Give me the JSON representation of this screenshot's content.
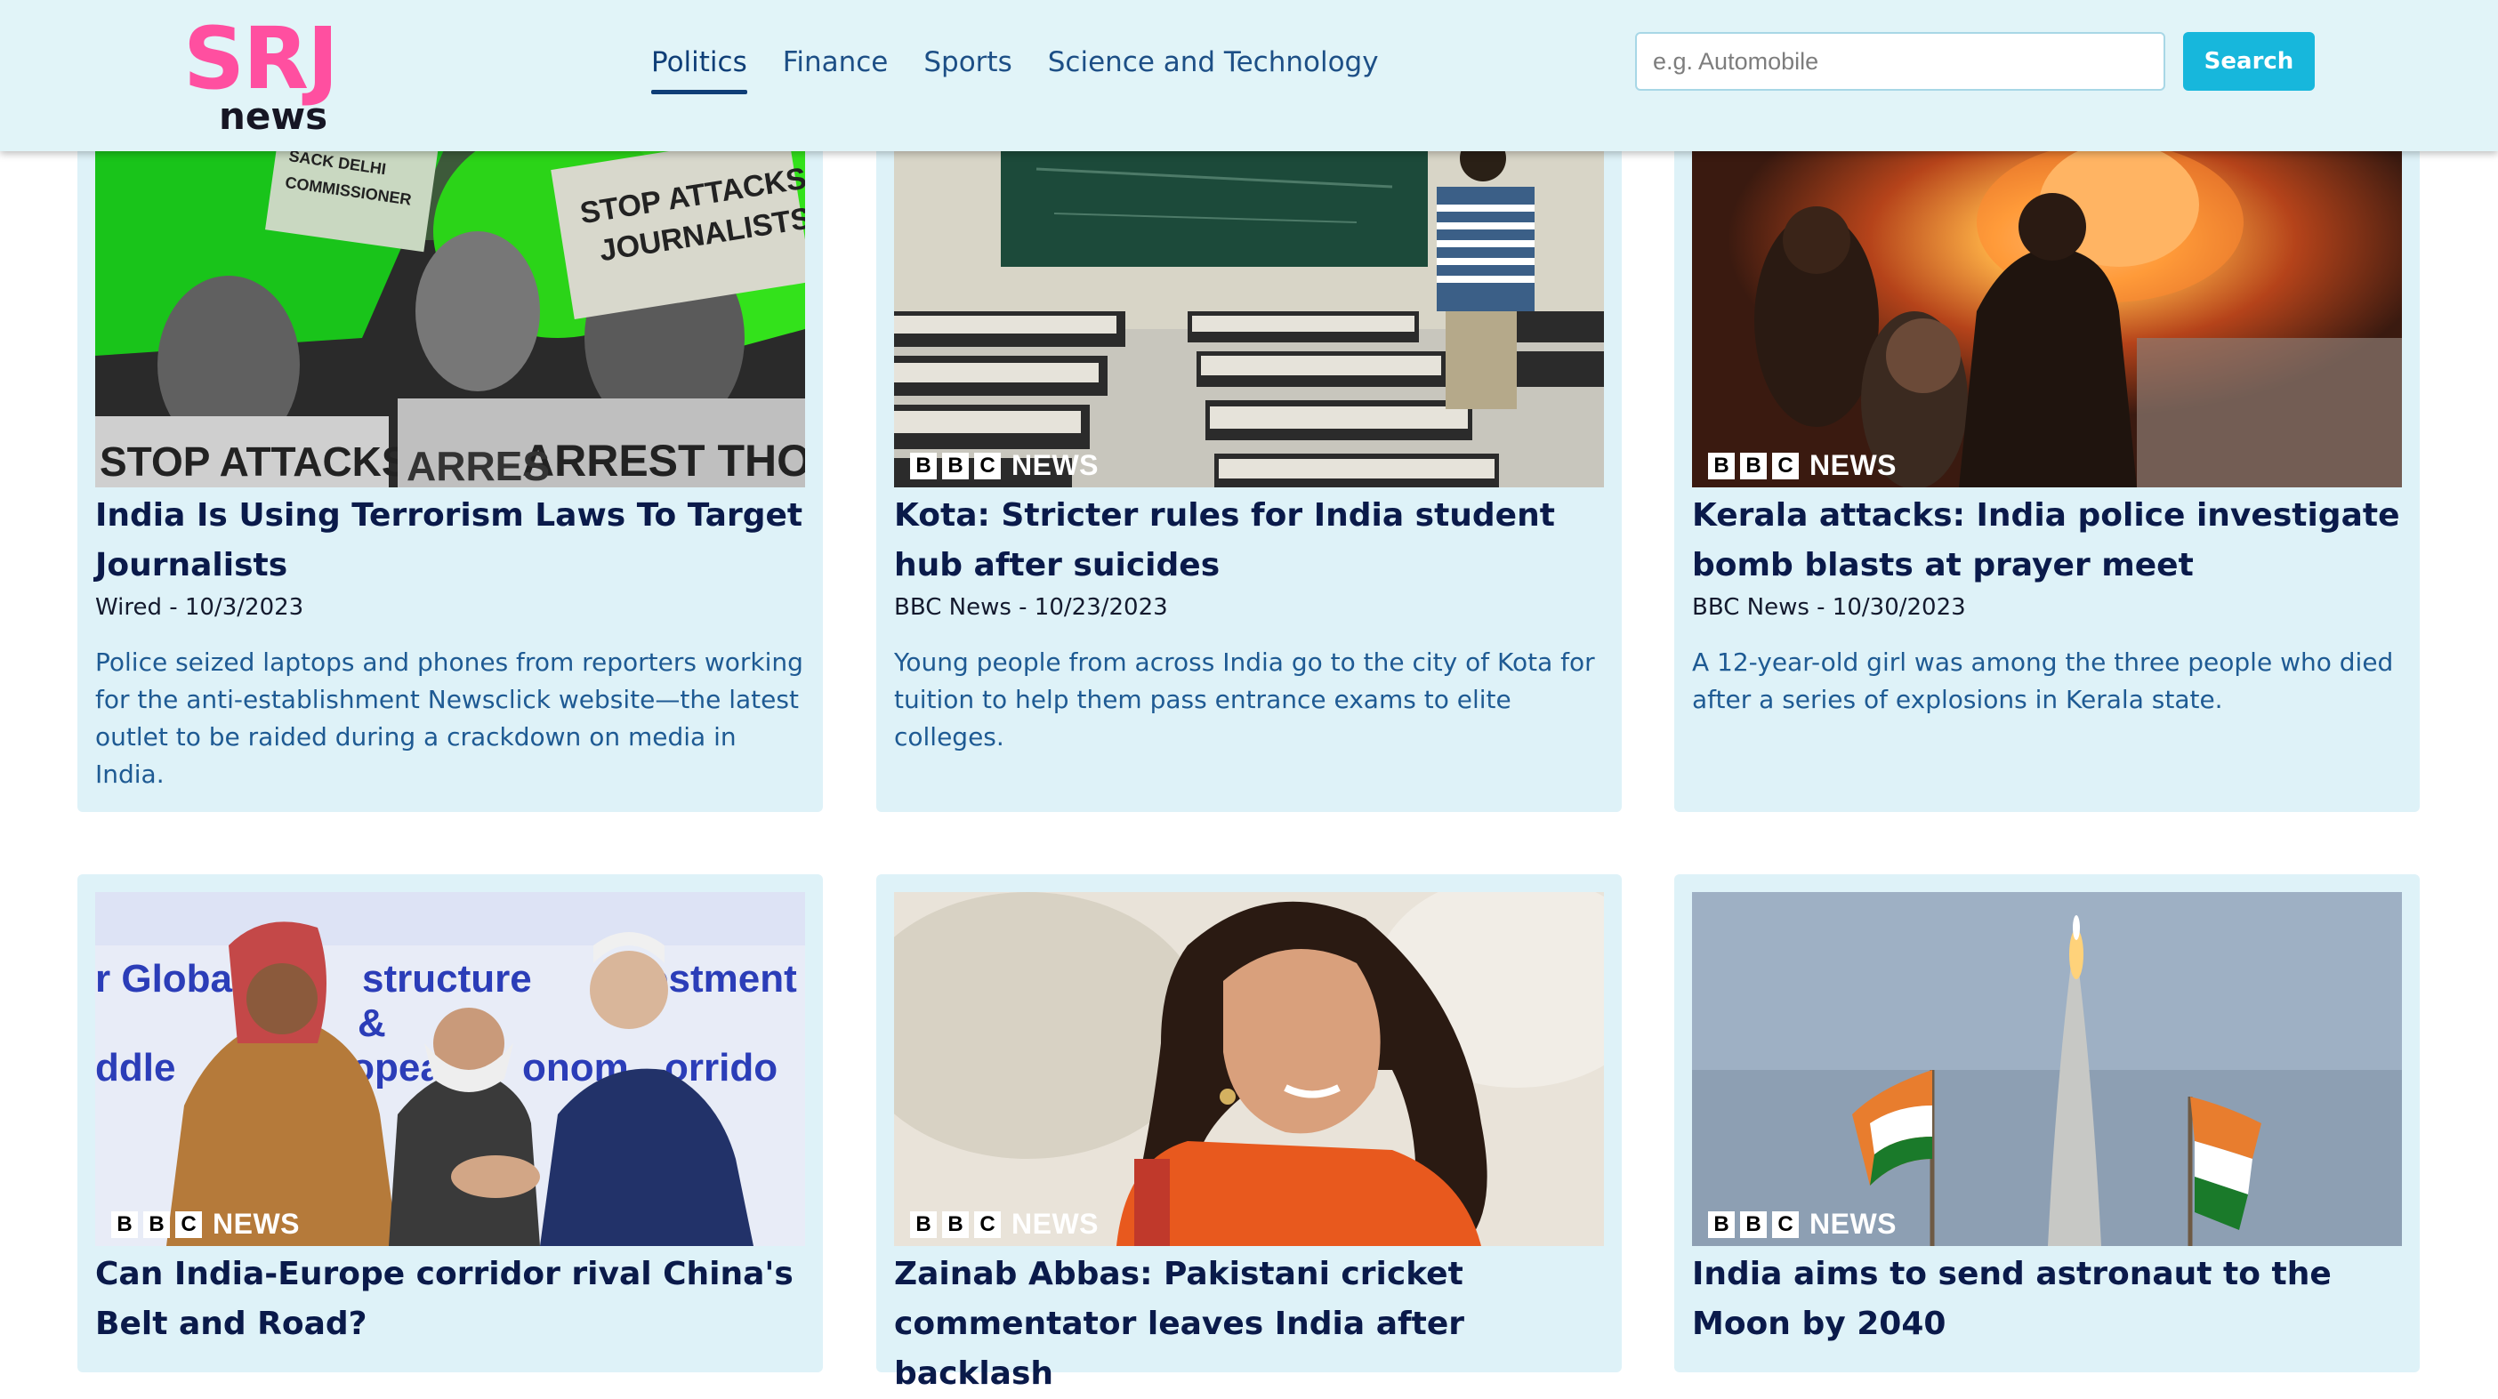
{
  "header": {
    "logo_main": "SRJ",
    "logo_sub": "news",
    "nav": [
      {
        "label": "Politics",
        "active": true
      },
      {
        "label": "Finance",
        "active": false
      },
      {
        "label": "Sports",
        "active": false
      },
      {
        "label": "Science and Technology",
        "active": false
      }
    ],
    "search_placeholder": "e.g. Automobile",
    "search_button": "Search"
  },
  "colors": {
    "header_bg": "#e1f4f8",
    "logo_pink": "#ff4fa0",
    "card_bg": "#def2f8",
    "accent": "#17b7dc",
    "title_navy": "#0a1a4a",
    "desc_blue": "#1e5a93"
  },
  "articles": [
    {
      "title": "India Is Using Terrorism Laws To Target Journalists",
      "meta": "Wired - 10/3/2023",
      "description": "Police seized laptops and phones from reporters working for the anti-establishment Newsclick website—the latest outlet to be raided during a crackdown on media in India.",
      "image": "protest-photo",
      "bbc_badge": false
    },
    {
      "title": "Kota: Stricter rules for India student hub after suicides",
      "meta": "BBC News - 10/23/2023",
      "description": "Young people from across India go to the city of Kota for tuition to help them pass entrance exams to elite colleges.",
      "image": "classroom-photo",
      "bbc_badge": true
    },
    {
      "title": "Kerala attacks: India police investigate bomb blasts at prayer meet",
      "meta": "BBC News - 10/30/2023",
      "description": "A 12-year-old girl was among the three people who died after a series of explosions in Kerala state.",
      "image": "fire-photo",
      "bbc_badge": true
    },
    {
      "title": "Can India-Europe corridor rival China's Belt and Road?",
      "image": "leaders-photo",
      "bbc_badge": true,
      "backdrop_text": [
        "r Global",
        "structure",
        "estment",
        "&",
        "ddle",
        "ropean",
        "onom",
        "orrido"
      ]
    },
    {
      "title": "Zainab Abbas: Pakistani cricket commentator leaves India after backlash",
      "image": "commentator-photo",
      "bbc_badge": true
    },
    {
      "title": "India aims to send astronaut to the Moon by 2040",
      "image": "rocket-photo",
      "bbc_badge": true
    }
  ],
  "bbc": {
    "b1": "B",
    "b2": "B",
    "b3": "C",
    "label": "NEWS"
  },
  "protest_signs": {
    "sign1": "STOP ATTACKS ON JOURNALISTS!",
    "sign2": "SACK DELHI POLICE COMMISSIONER",
    "sign3": "STOP ATTACKS ON",
    "sign4": "ARREST THOSE",
    "sign5": "ARRES"
  }
}
